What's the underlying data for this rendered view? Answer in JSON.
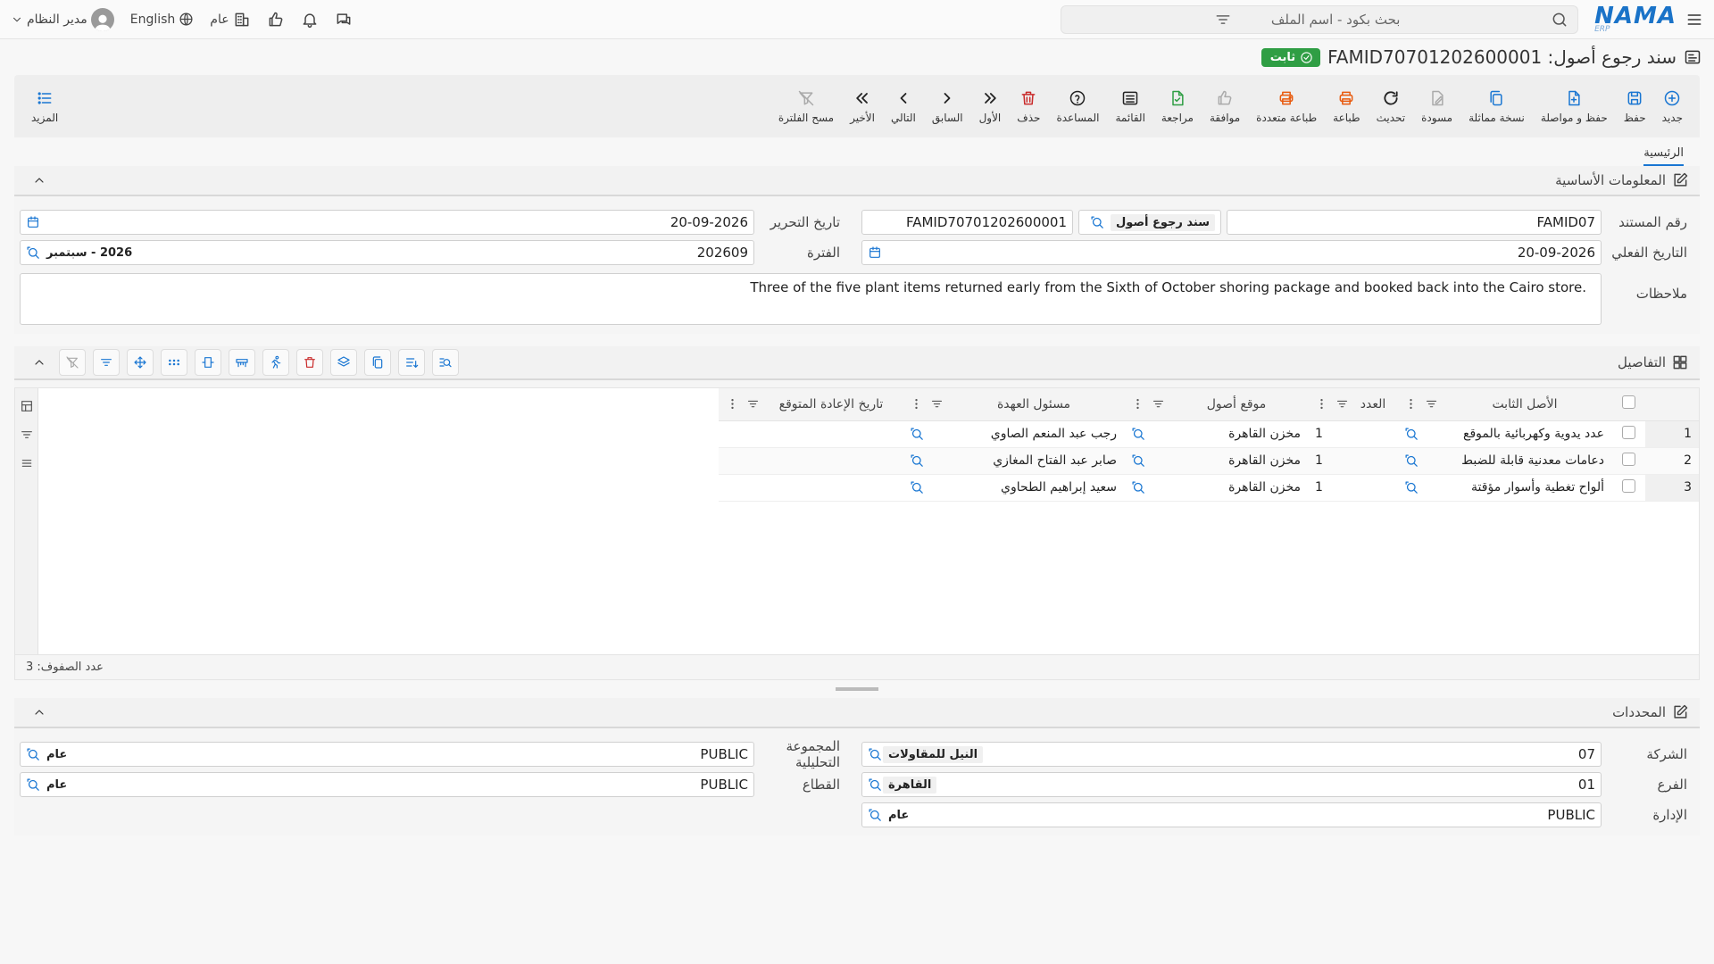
{
  "topbar": {
    "logo_main": "NAMA",
    "logo_sub": "ERP",
    "search_placeholder": "بحث بكود - اسم الملف",
    "public_label": "عام",
    "language_label": "English",
    "user_label": "مدير النظام"
  },
  "title": {
    "text": "سند رجوع أصول: FAMID70701202600001",
    "status": "ثابت"
  },
  "toolbar": [
    {
      "name": "new",
      "label": "جديد",
      "icon": "plus-circle-icon"
    },
    {
      "name": "save",
      "label": "حفظ",
      "icon": "save-icon"
    },
    {
      "name": "save-continue",
      "label": "حفظ و مواصلة",
      "icon": "file-plus-icon"
    },
    {
      "name": "duplicate",
      "label": "نسخة مماثلة",
      "icon": "copy-icon"
    },
    {
      "name": "draft",
      "label": "مسودة",
      "icon": "draft-icon"
    },
    {
      "name": "refresh",
      "label": "تحديث",
      "icon": "refresh-icon"
    },
    {
      "name": "print",
      "label": "طباعة",
      "icon": "printer-icon"
    },
    {
      "name": "multi-print",
      "label": "طباعة متعددة",
      "icon": "multi-printer-icon"
    },
    {
      "name": "approve",
      "label": "موافقة",
      "icon": "thumbs-up-icon"
    },
    {
      "name": "review",
      "label": "مراجعة",
      "icon": "review-icon"
    },
    {
      "name": "list",
      "label": "القائمة",
      "icon": "list-icon"
    },
    {
      "name": "help",
      "label": "المساعدة",
      "icon": "help-icon"
    },
    {
      "name": "delete",
      "label": "حذف",
      "icon": "trash-icon"
    },
    {
      "name": "first",
      "label": "الأول",
      "icon": "double-chevron-right-icon"
    },
    {
      "name": "previous",
      "label": "السابق",
      "icon": "chevron-right-icon"
    },
    {
      "name": "next",
      "label": "التالي",
      "icon": "chevron-left-icon"
    },
    {
      "name": "last",
      "label": "الأخير",
      "icon": "double-chevron-left-icon"
    },
    {
      "name": "clear-filter",
      "label": "مسح الفلترة",
      "icon": "filter-off-icon"
    }
  ],
  "more_label": "المزيد",
  "tabs": {
    "main": "الرئيسية"
  },
  "basic_info": {
    "title": "المعلومات الأساسية",
    "doc_number_label": "رقم المستند",
    "doc_number_prefix": "FAMID07",
    "doc_type": "سند رجوع أصول",
    "doc_number_full": "FAMID70701202600001",
    "edit_date_label": "تاريخ التحرير",
    "edit_date": "20-09-2026",
    "actual_date_label": "التاريخ الفعلي",
    "actual_date": "20-09-2026",
    "period_label": "الفترة",
    "period_code": "202609",
    "period_name": "2026 - سبتمبر",
    "notes_label": "ملاحظات",
    "notes": "Three of the five plant items returned early from the Sixth of October shoring package and booked back into the Cairo store."
  },
  "details": {
    "title": "التفاصيل",
    "columns": {
      "asset": "الأصل الثابت",
      "qty": "العدد",
      "location": "موقع أصول",
      "custodian": "مسئول العهدة",
      "return_date": "تاريخ الإعادة المتوقع"
    },
    "rows": [
      {
        "n": "1",
        "asset": "عدد يدوية وكهربائية بالموقع",
        "qty": "1",
        "location": "مخزن القاهرة",
        "custodian": "رجب عبد المنعم الصاوي",
        "return_date": ""
      },
      {
        "n": "2",
        "asset": "دعامات معدنية قابلة للضبط",
        "qty": "1",
        "location": "مخزن القاهرة",
        "custodian": "صابر عبد الفتاح المغازي",
        "return_date": ""
      },
      {
        "n": "3",
        "asset": "ألواح تغطية وأسوار مؤقتة",
        "qty": "1",
        "location": "مخزن القاهرة",
        "custodian": "سعيد إبراهيم الطحاوي",
        "return_date": ""
      }
    ],
    "row_count": "عدد الصفوف: 3"
  },
  "dimensions": {
    "title": "المحددات",
    "company_label": "الشركة",
    "company_code": "07",
    "company_name": "النيل للمقاولات",
    "branch_label": "الفرع",
    "branch_code": "01",
    "branch_name": "القاهرة",
    "dept_label": "الإدارة",
    "dept_code": "PUBLIC",
    "dept_name": "عام",
    "analytic_label": "المجموعة التحليلية",
    "analytic_code": "PUBLIC",
    "analytic_name": "عام",
    "sector_label": "القطاع",
    "sector_code": "PUBLIC",
    "sector_name": "عام"
  },
  "colors": {
    "accent": "#1976d2",
    "ok": "#2f9e44",
    "danger": "#c92a2a",
    "print": "#e8590c"
  }
}
